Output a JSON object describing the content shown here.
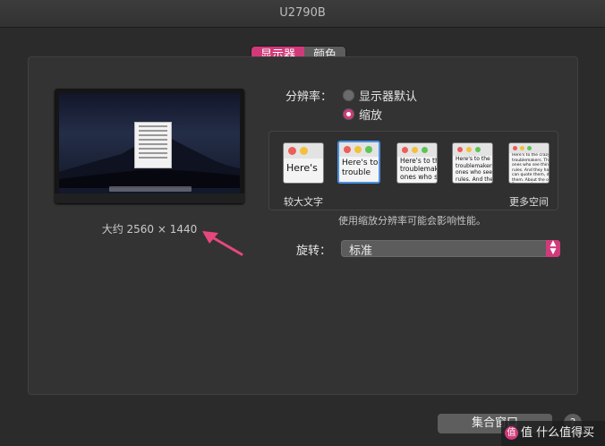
{
  "window": {
    "title": "U2790B"
  },
  "tabs": [
    {
      "label": "显示器",
      "active": true
    },
    {
      "label": "颜色",
      "active": false
    }
  ],
  "display": {
    "resolution_text": "大约 2560 × 1440",
    "resolution_label": "分辨率：",
    "options": [
      {
        "label": "显示器默认",
        "selected": false
      },
      {
        "label": "缩放",
        "selected": true
      }
    ],
    "scale_thumbs": [
      {
        "text": "Here's",
        "selected": false
      },
      {
        "text": "Here's to\ntrouble",
        "selected": true
      },
      {
        "text": "Here's to th\ntroublemak\nones who se",
        "selected": false
      },
      {
        "text": "Here's to the c\ntroublemakers\nones who see t\nrules. And they",
        "selected": false
      },
      {
        "text": "Here's to the crazy one\ntroublemakers. The rou\nones who see things di\nrules. And they have n\ncan quote them, disagr\nthem. About the only th\nBecause they change t",
        "selected": false
      }
    ],
    "larger_text_caption": "较大文字",
    "more_space_caption": "更多空间",
    "note": "使用缩放分辨率可能会影响性能。",
    "rotation_label": "旋转：",
    "rotation_value": "标准"
  },
  "footer": {
    "gather_button": "集合窗口",
    "help": "?",
    "watermark": "值 什么值得买"
  },
  "colors": {
    "accent": "#d13a7a",
    "selection": "#4a90e2",
    "arrow": "#e8467f"
  }
}
